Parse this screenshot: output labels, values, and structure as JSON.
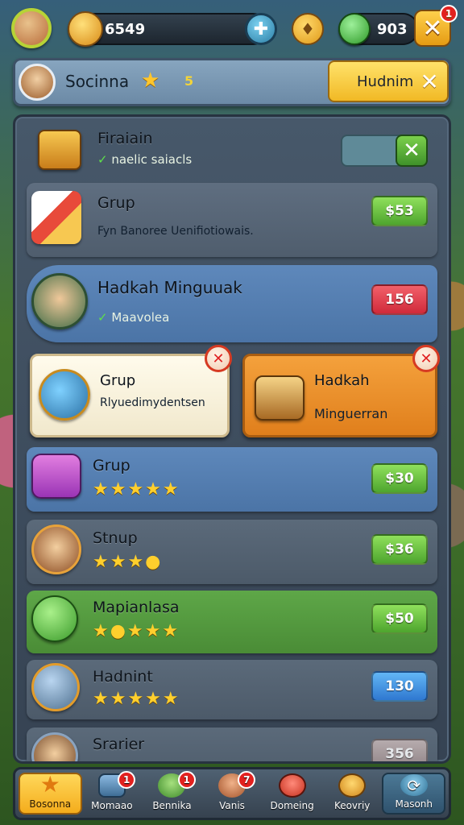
{
  "top_bar": {
    "coins": "6549",
    "gems": "903",
    "close_badge": "1",
    "icons": {
      "avatar": "player-avatar",
      "coin": "gold-coin-icon",
      "plus": "plus-icon",
      "drop": "gold-drop-icon",
      "gem": "green-gem-icon",
      "close": "close-icon"
    }
  },
  "profile": {
    "name": "Socinna",
    "level": "5",
    "action_label": "Hudnim"
  },
  "rows": [
    {
      "title": "Firaiain",
      "subtitle": "naelic saiacls",
      "check": "✓",
      "control": "toggle"
    },
    {
      "title": "Grup",
      "subtitle": "Fyn Banoree Uenifiotiowais.",
      "price": "$53",
      "price_color": "green"
    },
    {
      "title": "Hadkah Minguuak",
      "subtitle": "Maavolea",
      "check": "✓",
      "price": "156",
      "price_color": "red"
    },
    {
      "title": "Grup",
      "stars": "★★★★★",
      "price": "$30",
      "price_color": "green"
    },
    {
      "title": "Stnup",
      "stars": "★★★●",
      "price": "$36",
      "price_color": "green"
    },
    {
      "title": "Mapianlasa",
      "stars": "★●★★★",
      "price": "$50",
      "price_color": "green"
    },
    {
      "title": "Hadnint",
      "stars": "★★★★★",
      "price": "130",
      "price_color": "blue"
    },
    {
      "title": "Srarier",
      "price": "356",
      "price_color": "dim"
    }
  ],
  "cards": [
    {
      "title": "Grup",
      "subtitle": "Rlyuedimydentsen"
    },
    {
      "title": "Hadkah",
      "subtitle": "Minguerran"
    }
  ],
  "nav": [
    {
      "label": "Bosonna",
      "active": true
    },
    {
      "label": "Momaao",
      "badge": "1"
    },
    {
      "label": "Bennika",
      "badge": "1"
    },
    {
      "label": "Vanis",
      "badge": "7"
    },
    {
      "label": "Domeing"
    },
    {
      "label": "Keovriy"
    },
    {
      "label": "Masonh"
    }
  ],
  "colors": {
    "accent_yellow": "#f4ac1c",
    "price_green": "#4ea52e",
    "price_red": "#d02a3a",
    "price_blue": "#2f78d0",
    "badge_red": "#e2211f"
  }
}
